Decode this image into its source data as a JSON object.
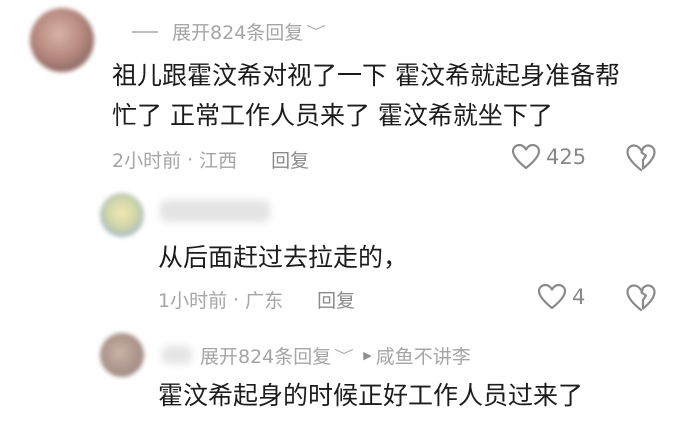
{
  "comment1": {
    "expand_label": "展开824条回复",
    "text_line1": "祖儿跟霍汶希对视了一下 霍汶希就起身准备帮",
    "text_line2": "忙了 正常工作人员来了 霍汶希就坐下了",
    "time": "2小时前",
    "separator": "·",
    "location": "江西",
    "reply_label": "回复",
    "like_count": "425"
  },
  "comment2": {
    "text": "从后面赶过去拉走的，",
    "time": "1小时前",
    "separator": "·",
    "location": "广东",
    "reply_label": "回复",
    "like_count": "4"
  },
  "comment3": {
    "expand_label": "展开824条回复",
    "reply_to": "咸鱼不讲李",
    "text": "霍汶希起身的时候正好工作人员过来了"
  },
  "icons": {
    "like": "heart-outline-icon",
    "dislike": "broken-heart-icon",
    "expand": "chevron-down-icon",
    "reply_arrow": "play-triangle-icon"
  }
}
